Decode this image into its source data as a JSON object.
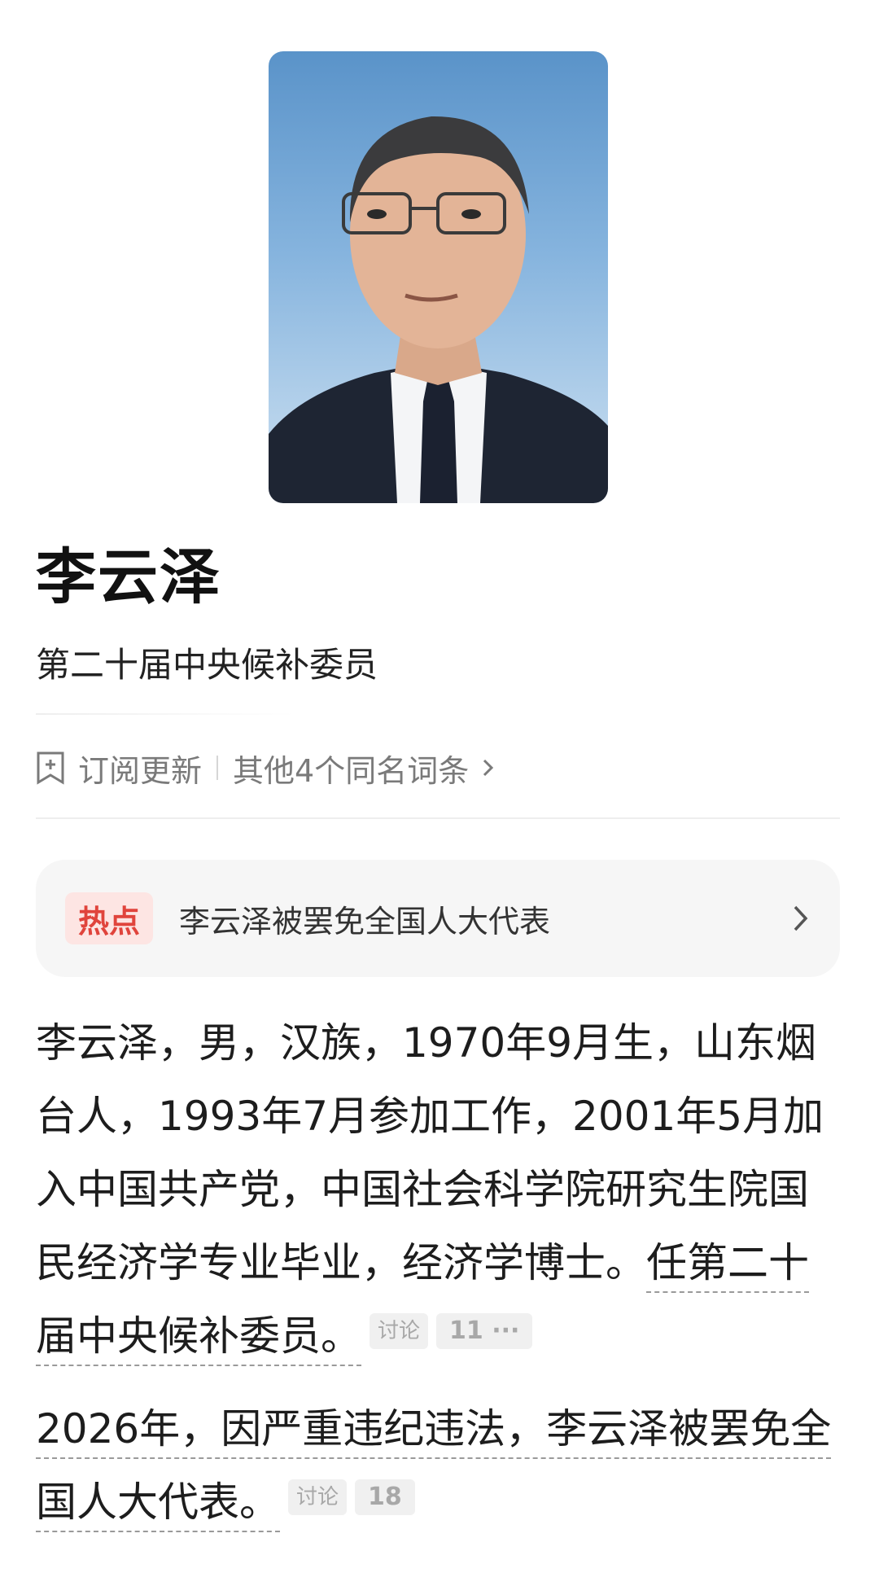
{
  "profile": {
    "name": "李云泽",
    "subtitle": "第二十届中央候补委员"
  },
  "meta": {
    "subscribe_label": "订阅更新",
    "same_name_label": "其他4个同名词条"
  },
  "hot": {
    "badge": "热点",
    "text": "李云泽被罢免全国人大代表"
  },
  "paragraphs": {
    "p1_text": "李云泽，男，汉族，1970年9月生，山东烟台人，1993年7月参加工作，2001年5月加入中国共产党，中国社会科学院研究生院国民经济学专业毕业，经济学博士。",
    "p1_tail": "任第二十届中央候补委员。",
    "p1_discuss": "讨论",
    "p1_count": "11 ···",
    "p2_text": "2026年，因严重违纪违法，李云泽被罢免全国人大代表。",
    "p2_discuss": "讨论",
    "p2_count": "18"
  },
  "icons": [
    "bookmark-icon",
    "chevron-right-icon"
  ],
  "colors": {
    "hot_badge_bg": "#fde5e3",
    "hot_badge_text": "#e0443c",
    "card_bg": "#f6f6f6"
  }
}
